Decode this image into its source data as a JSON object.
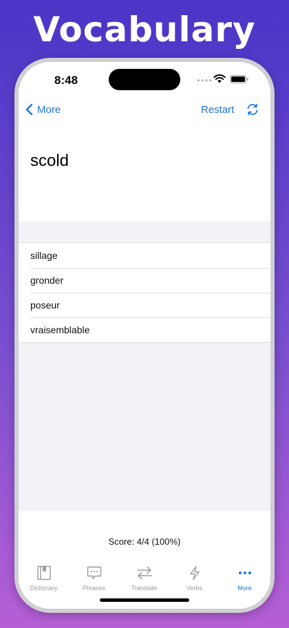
{
  "promo": {
    "title": "Vocabulary"
  },
  "status_bar": {
    "time": "8:48"
  },
  "nav": {
    "back_label": "More",
    "restart_label": "Restart"
  },
  "quiz": {
    "word": "scold",
    "options": [
      {
        "text": "sillage"
      },
      {
        "text": "gronder"
      },
      {
        "text": "poseur"
      },
      {
        "text": "vraisemblable"
      }
    ],
    "score": "Score: 4/4 (100%)"
  },
  "tabs": [
    {
      "label": "Dictionary",
      "icon": "book-icon",
      "active": false
    },
    {
      "label": "Phrases",
      "icon": "chat-bubble-icon",
      "active": false
    },
    {
      "label": "Translate",
      "icon": "swap-arrows-icon",
      "active": false
    },
    {
      "label": "Verbs",
      "icon": "lightning-icon",
      "active": false
    },
    {
      "label": "More",
      "icon": "more-dots-icon",
      "active": true
    }
  ],
  "colors": {
    "accent": "#1a73e8",
    "inactive_tab": "#9a9aa0",
    "background_gray": "#f2f2f7"
  }
}
